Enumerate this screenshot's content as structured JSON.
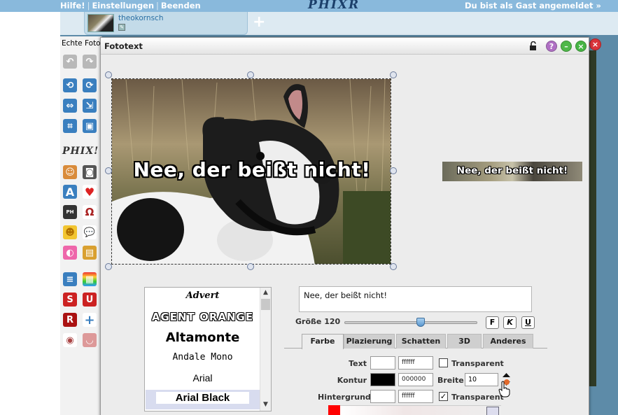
{
  "topbar": {
    "help": "Hilfe!",
    "settings": "Einstellungen",
    "quit": "Beenden",
    "logo": "PHIXR",
    "guest": "Du bist als Gast angemeldet »"
  },
  "tabs": [
    {
      "name": "theokornsch"
    }
  ],
  "add_tab": "+",
  "sidepanel": {
    "header": "Echte Fotos",
    "phix": "PHIX!"
  },
  "dialog": {
    "title": "Fototext",
    "help": "?",
    "minimize": "–",
    "close": "×"
  },
  "canvas": {
    "caption": "Nee, der beißt nicht!",
    "preview_caption": "Nee, der beißt nicht!"
  },
  "fonts": {
    "items": [
      "Advert",
      "AGENT ORANGE",
      "Altamonte",
      "Andale Mono",
      "Arial",
      "Arial Black"
    ],
    "selected": "Arial Black"
  },
  "text_input": {
    "value": "Nee, der beißt nicht!"
  },
  "size": {
    "label": "Größe 120",
    "value": 120
  },
  "format_buttons": {
    "bold": "F",
    "italic": "K",
    "underline": "U"
  },
  "prop_tabs": [
    "Farbe",
    "Plazierung",
    "Schatten",
    "3D",
    "Anderes"
  ],
  "active_tab": "Farbe",
  "color_form": {
    "text_label": "Text",
    "text_hex": "ffffff",
    "contour_label": "Kontur",
    "contour_hex": "000000",
    "background_label": "Hintergrund",
    "background_hex": "ffffff",
    "transparent_label": "Transparent",
    "transparent_label_2": "Transparent",
    "width_label": "Breite",
    "width_value": "10",
    "text_transparent_checked": false,
    "background_transparent_checked": true,
    "checkmark": "✓"
  },
  "colors": {
    "topbar": "#89b9dc",
    "contour_swatch": "#000000",
    "text_swatch": "#ffffff"
  }
}
